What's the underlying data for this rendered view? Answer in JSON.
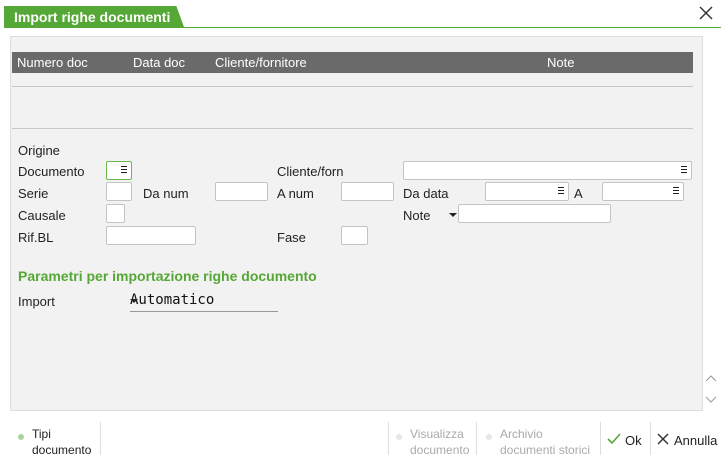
{
  "window": {
    "title": "Import righe documenti",
    "close_icon": "close-icon"
  },
  "grid": {
    "columns": [
      "Numero doc",
      "Data doc",
      "Cliente/fornitore",
      "Note"
    ]
  },
  "form": {
    "origine_label": "Origine",
    "documento_label": "Documento",
    "cliente_forn_label": "Cliente/forn",
    "serie_label": "Serie",
    "da_num_label": "Da num",
    "a_num_label": "A num",
    "da_data_label": "Da data",
    "a_label": "A",
    "causale_label": "Causale",
    "note_label": "Note",
    "rif_bl_label": "Rif.BL",
    "fase_label": "Fase"
  },
  "params": {
    "section_title": "Parametri per importazione righe documento",
    "import_label": "Import",
    "import_value": "Automatico"
  },
  "toolbar": {
    "tipi_line1": "Tipi",
    "tipi_line2": "documento",
    "visualizza_line1": "Visualizza",
    "visualizza_line2": "documento",
    "archivio_line1": "Archivio",
    "archivio_line2": "documenti storici",
    "ok_label": "Ok",
    "annulla_label": "Annulla"
  },
  "colors": {
    "accent": "#55a835",
    "grid_header": "#6a6a6a",
    "panel": "#f2f2f2"
  }
}
